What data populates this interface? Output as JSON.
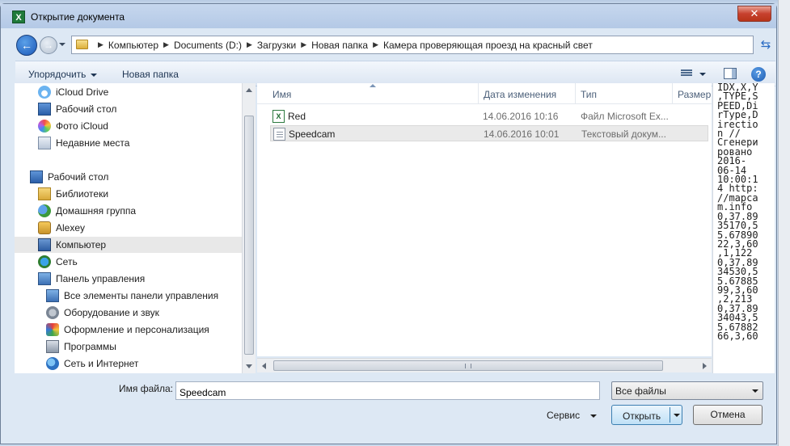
{
  "window": {
    "title": "Открытие документа",
    "app_icon": "excel-icon",
    "close_label": "✕"
  },
  "address": {
    "crumbs": [
      "Компьютер",
      "Documents (D:)",
      "Загрузки",
      "Новая папка",
      "Камера проверяющая проезд на красный свет"
    ]
  },
  "toolbar": {
    "organize_label": "Упорядочить",
    "new_folder_label": "Новая папка",
    "help_label": "?"
  },
  "nav": {
    "items": [
      {
        "label": "iCloud Drive"
      },
      {
        "label": "Рабочий стол"
      },
      {
        "label": "Фото iCloud"
      },
      {
        "label": "Недавние места"
      },
      {
        "label": "Рабочий стол"
      },
      {
        "label": "Библиотеки"
      },
      {
        "label": "Домашняя группа"
      },
      {
        "label": "Alexey"
      },
      {
        "label": "Компьютер"
      },
      {
        "label": "Сеть"
      },
      {
        "label": "Панель управления"
      },
      {
        "label": "Все элементы панели управления"
      },
      {
        "label": "Оборудование и звук"
      },
      {
        "label": "Оформление и персонализация"
      },
      {
        "label": "Программы"
      },
      {
        "label": "Сеть и Интернет"
      }
    ]
  },
  "filelist": {
    "columns": {
      "name": "Имя",
      "date": "Дата изменения",
      "type": "Тип",
      "size": "Размер"
    },
    "rows": [
      {
        "name": "Red",
        "date": "14.06.2016 10:16",
        "type": "Файл Microsoft Ex..."
      },
      {
        "name": "Speedcam",
        "date": "14.06.2016 10:01",
        "type": "Текстовый докум..."
      }
    ]
  },
  "preview": {
    "text": "IDX,X,Y\n,TYPE,S\nPEED,Di\nrType,D\nirectio\nn //\nСгенери\nровано\n2016-\n06-14\n10:00:1\n4 http:\n//mapca\nm.info\n0,37.89\n35170,5\n5.67890\n22,3,60\n,1,122\n0,37.89\n34530,5\n5.67885\n99,3,60\n,2,213\n0,37.89\n34043,5\n5.67882\n66,3,60"
  },
  "footer": {
    "filename_label": "Имя файла:",
    "filename_value": "Speedcam",
    "filter_value": "Все файлы",
    "service_label": "Сервис",
    "open_label": "Открыть",
    "cancel_label": "Отмена"
  }
}
